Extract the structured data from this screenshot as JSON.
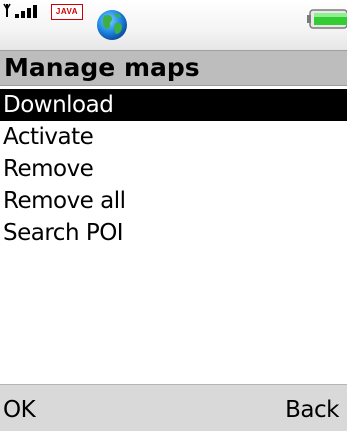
{
  "status_bar": {
    "java_badge": "JAVA",
    "icons": [
      "signal-strength-icon",
      "java-icon",
      "globe-icon",
      "battery-icon"
    ],
    "battery_color": "#33cc33"
  },
  "title": "Manage maps",
  "menu": {
    "selected_index": 0,
    "items": [
      {
        "label": "Download"
      },
      {
        "label": "Activate"
      },
      {
        "label": "Remove"
      },
      {
        "label": "Remove all"
      },
      {
        "label": "Search POI"
      }
    ]
  },
  "softkeys": {
    "left": "OK",
    "right": "Back"
  },
  "colors": {
    "selection_bg": "#000000",
    "selection_fg": "#ffffff",
    "title_bar_bg": "#bdbdbd",
    "softkey_bar_bg": "#d9d9d9"
  }
}
